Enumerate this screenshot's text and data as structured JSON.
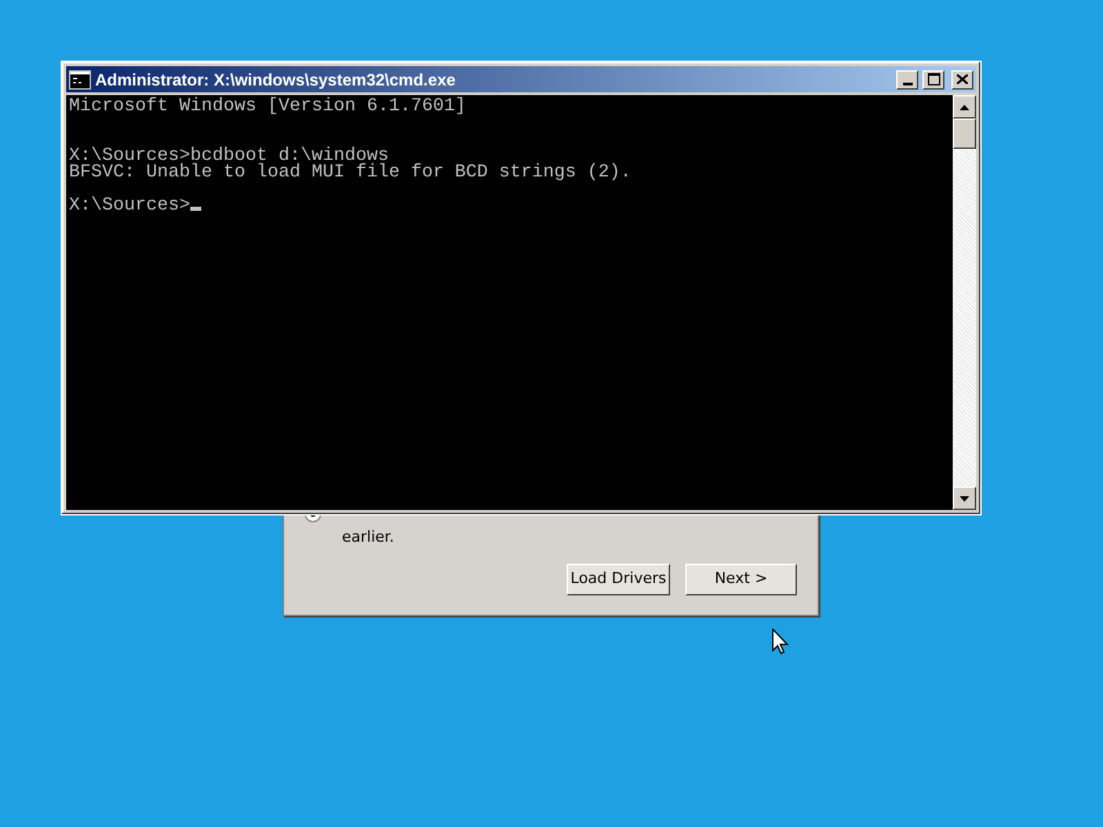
{
  "window": {
    "title": "Administrator: X:\\windows\\system32\\cmd.exe"
  },
  "console": {
    "lines": [
      {
        "kind": "text",
        "text": "Microsoft Windows [Version 6.1.7601]"
      },
      {
        "kind": "blank"
      },
      {
        "kind": "blank"
      },
      {
        "kind": "text",
        "text": "X:\\Sources>bcdboot d:\\windows"
      },
      {
        "kind": "text",
        "text": "BFSVC: Unable to load MUI file for BCD strings (2)."
      },
      {
        "kind": "blank"
      },
      {
        "kind": "text",
        "text": "X:\\Sources>",
        "cursor": true
      }
    ]
  },
  "dialog": {
    "option": {
      "text": "earlier.",
      "selected": true
    },
    "buttons": [
      "Load Drivers",
      "Next >"
    ]
  }
}
